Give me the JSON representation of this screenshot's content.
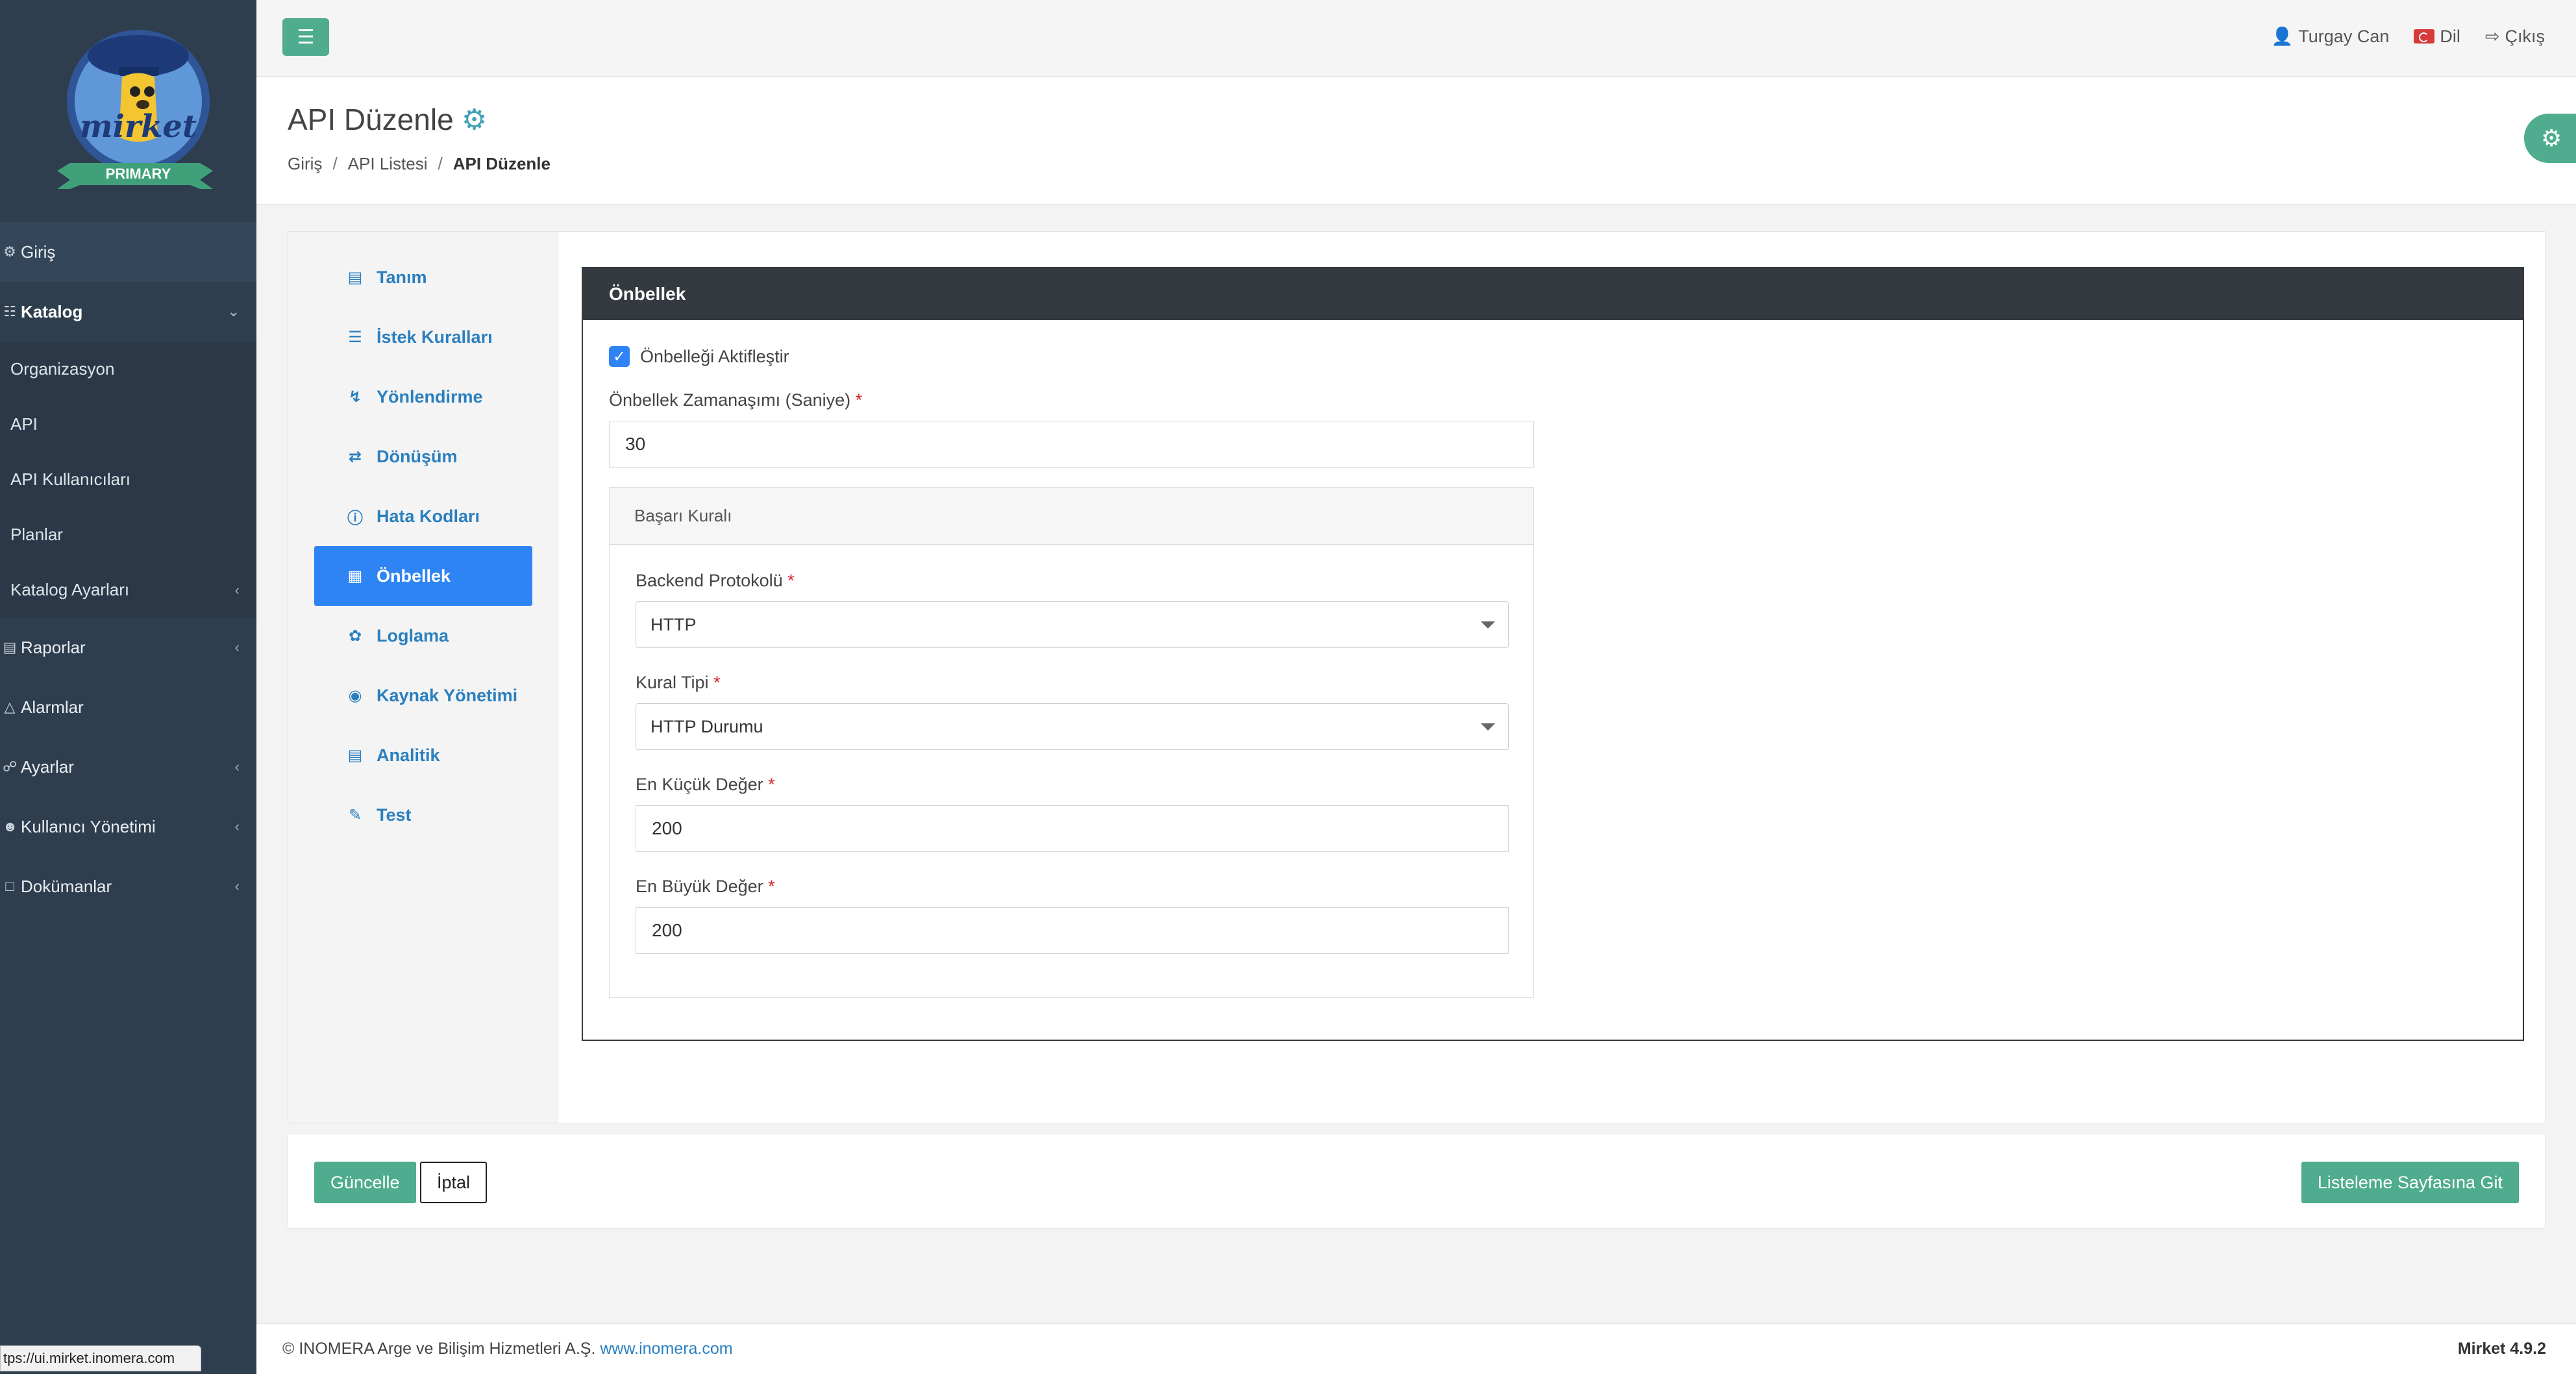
{
  "brand": {
    "logo_text": "mirket",
    "ribbon_text": "PRIMARY"
  },
  "sidebar": {
    "items": [
      {
        "label": "Giriş",
        "icon": "gauge-icon"
      },
      {
        "label": "Katalog",
        "icon": "sitemap-icon",
        "expanded": true,
        "children": [
          {
            "label": "Organizasyon"
          },
          {
            "label": "API"
          },
          {
            "label": "API Kullanıcıları"
          },
          {
            "label": "Planlar"
          },
          {
            "label": "Katalog Ayarları"
          }
        ]
      },
      {
        "label": "Raporlar",
        "icon": "chart-icon"
      },
      {
        "label": "Alarmlar",
        "icon": "bell-icon"
      },
      {
        "label": "Ayarlar",
        "icon": "share-icon"
      },
      {
        "label": "Kullanıcı Yönetimi",
        "icon": "users-icon"
      },
      {
        "label": "Dokümanlar",
        "icon": "document-icon"
      }
    ]
  },
  "topbar": {
    "user": "Turgay Can",
    "language": "Dil",
    "logout": "Çıkış"
  },
  "header": {
    "title": "API Düzenle",
    "breadcrumb": [
      "Giriş",
      "API Listesi",
      "API Düzenle"
    ]
  },
  "tabs": [
    {
      "label": "Tanım",
      "icon": "id-card-icon"
    },
    {
      "label": "İstek Kuralları",
      "icon": "list-icon"
    },
    {
      "label": "Yönlendirme",
      "icon": "bolt-icon"
    },
    {
      "label": "Dönüşüm",
      "icon": "exchange-icon"
    },
    {
      "label": "Hata Kodları",
      "icon": "exclamation-icon"
    },
    {
      "label": "Önbellek",
      "icon": "memory-icon",
      "active": true
    },
    {
      "label": "Loglama",
      "icon": "leaf-icon"
    },
    {
      "label": "Kaynak Yönetimi",
      "icon": "lock-icon"
    },
    {
      "label": "Analitik",
      "icon": "chart-line-icon"
    },
    {
      "label": "Test",
      "icon": "pencil-icon"
    }
  ],
  "cache": {
    "panel_title": "Önbellek",
    "enable_label": "Önbelleği Aktifleştir",
    "enabled": true,
    "timeout_label": "Önbellek Zamanaşımı (Saniye)",
    "timeout_value": "30",
    "required_mark": "*",
    "success_rule": {
      "title": "Başarı Kuralı",
      "protocol_label": "Backend Protokolü",
      "protocol_value": "HTTP",
      "rule_type_label": "Kural Tipi",
      "rule_type_value": "HTTP Durumu",
      "min_label": "En Küçük Değer",
      "min_value": "200",
      "max_label": "En Büyük Değer",
      "max_value": "200"
    }
  },
  "actions": {
    "update": "Güncelle",
    "cancel": "İptal",
    "goto_list": "Listeleme Sayfasına Git"
  },
  "footer": {
    "copyright": "© INOMERA Arge ve Bilişim Hizmetleri A.Ş.",
    "link": "www.inomera.com",
    "version": "Mirket 4.9.2"
  },
  "status_url": "tps://ui.mirket.inomera.com",
  "colors": {
    "sidebar_bg": "#2f3e4e",
    "accent_green": "#4fac8e",
    "active_tab_blue": "#2f84f5",
    "panel_header": "#343a40",
    "link_blue": "#2a7fbf",
    "required_red": "#d9232d"
  }
}
